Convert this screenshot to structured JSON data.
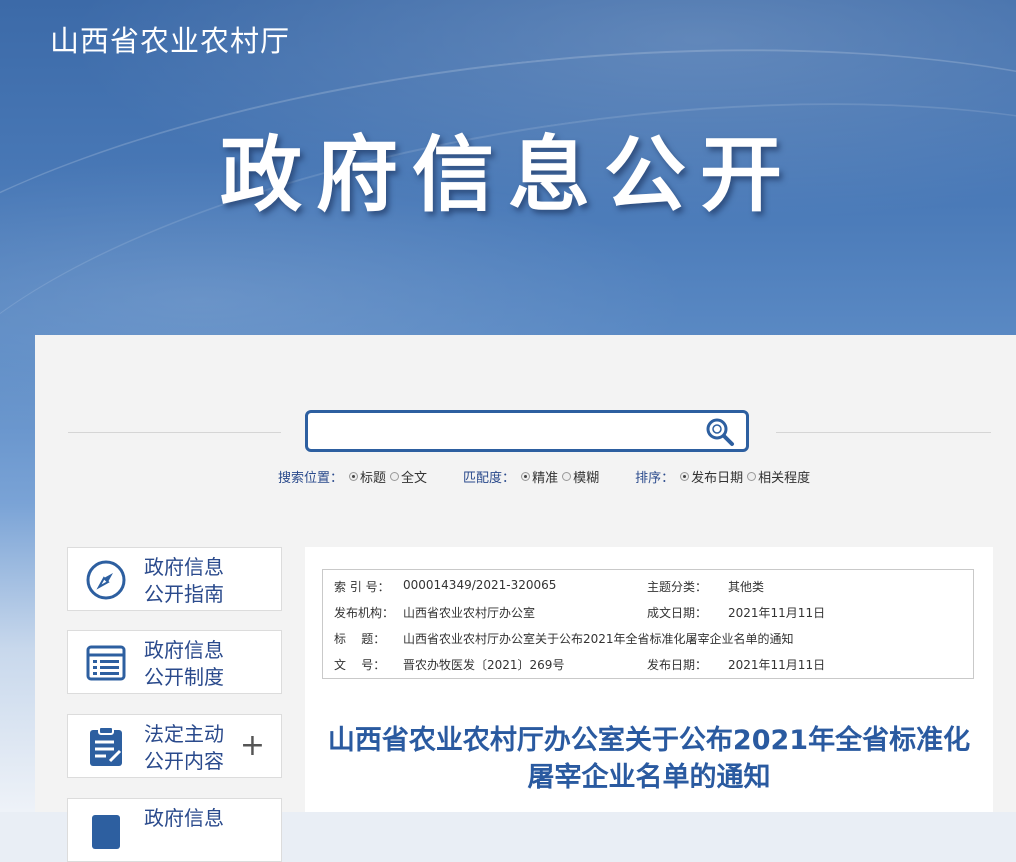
{
  "header": {
    "org_name": "山西省农业农村厅",
    "hero_title": "政府信息公开"
  },
  "search": {
    "value": "",
    "options": [
      {
        "label": "搜索位置：",
        "choices": [
          {
            "text": "标题",
            "selected": true
          },
          {
            "text": "全文",
            "selected": false
          }
        ]
      },
      {
        "label": "匹配度：",
        "choices": [
          {
            "text": "精准",
            "selected": true
          },
          {
            "text": "模糊",
            "selected": false
          }
        ]
      },
      {
        "label": "排序：",
        "choices": [
          {
            "text": "发布日期",
            "selected": true
          },
          {
            "text": "相关程度",
            "selected": false
          }
        ]
      }
    ]
  },
  "sidebar": {
    "items": [
      {
        "line1": "政府信息",
        "line2": "公开指南",
        "icon": "compass-icon"
      },
      {
        "line1": "政府信息",
        "line2": "公开制度",
        "icon": "list-icon"
      },
      {
        "line1": "法定主动",
        "line2": "公开内容",
        "icon": "clipboard-icon",
        "expand": "+"
      },
      {
        "line1": "政府信息",
        "line2": "",
        "icon": "document-icon"
      }
    ]
  },
  "meta": {
    "rows": [
      {
        "k1": "索 引 号：",
        "v1": "000014349/2021-320065",
        "k2": "主题分类：",
        "v2": "其他类"
      },
      {
        "k1": "发布机构：",
        "v1": "山西省农业农村厅办公室",
        "k2": "成文日期：",
        "v2": "2021年11月11日"
      },
      {
        "k1": "标    题：",
        "v1": "山西省农业农村厅办公室关于公布2021年全省标准化屠宰企业名单的通知",
        "k2": "",
        "v2": ""
      },
      {
        "k1": "文    号：",
        "v1": "晋农办牧医发〔2021〕269号",
        "k2": "发布日期：",
        "v2": "2021年11月11日"
      }
    ]
  },
  "document": {
    "title_line1": "山西省农业农村厅办公室关于公布2021年全省标准化",
    "title_line2": "屠宰企业名单的通知"
  },
  "colors": {
    "accent": "#2d5fa0",
    "link_blue": "#2a4a8c",
    "title_blue": "#2a5aa0"
  }
}
